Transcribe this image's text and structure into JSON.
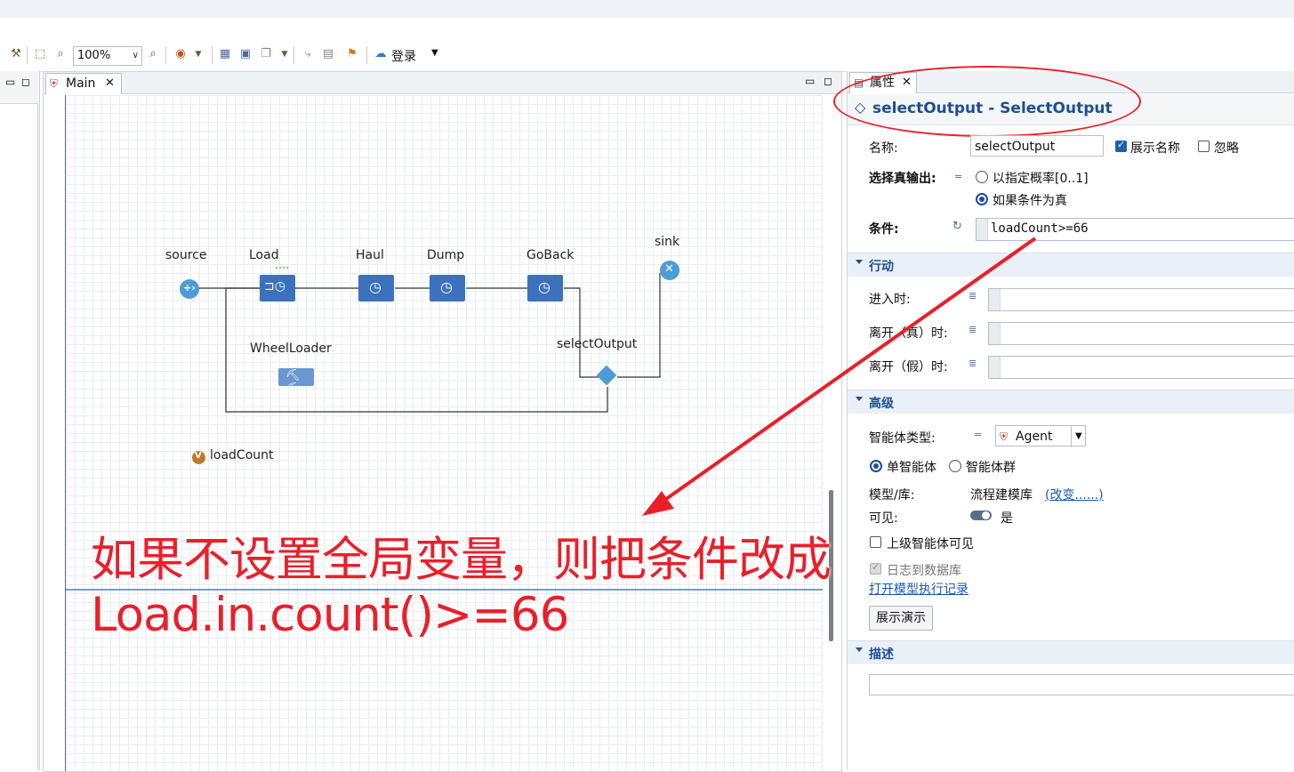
{
  "toolbar": {
    "zoom": "100%",
    "login_label": "登录"
  },
  "editor": {
    "tab_label": "Main",
    "blocks": {
      "source": "source",
      "load": "Load",
      "haul": "Haul",
      "dump": "Dump",
      "goback": "GoBack",
      "sink": "sink",
      "select_output": "selectOutput",
      "wheel_loader": "WheelLoader",
      "load_count": "loadCount"
    }
  },
  "props": {
    "tab_label": "属性",
    "header": "selectOutput - SelectOutput",
    "name_label": "名称:",
    "name_value": "selectOutput",
    "show_name_label": "展示名称",
    "ignore_label": "忽略",
    "select_true_label": "选择真输出:",
    "prob_option": "以指定概率[0..1]",
    "cond_option": "如果条件为真",
    "condition_label": "条件:",
    "condition_value": "loadCount>=66",
    "section_action": "行动",
    "on_enter_label": "进入时:",
    "on_exit_true_label": "离开（真）时:",
    "on_exit_false_label": "离开（假）时:",
    "section_advanced": "高级",
    "agent_type_label": "智能体类型:",
    "agent_type_value": "Agent",
    "single_agent": "单智能体",
    "agent_population": "智能体群",
    "model_lib_label": "模型/库:",
    "model_lib_value": "流程建模库",
    "change_link": "(改变......)",
    "visible_label": "可见:",
    "visible_value": "是",
    "upper_visible": "上级智能体可见",
    "log_db": "日志到数据库",
    "open_log_link": "打开模型执行记录",
    "show_demo_button": "展示演示",
    "section_desc": "描述"
  },
  "annotation": {
    "line1": "如果不设置全局变量，则把条件改成",
    "line2": "Load.in.count()>=66"
  },
  "colors": {
    "block_blue": "#3c71bd",
    "header_blue": "#1d4f93",
    "annotation_red": "#e8202a"
  }
}
